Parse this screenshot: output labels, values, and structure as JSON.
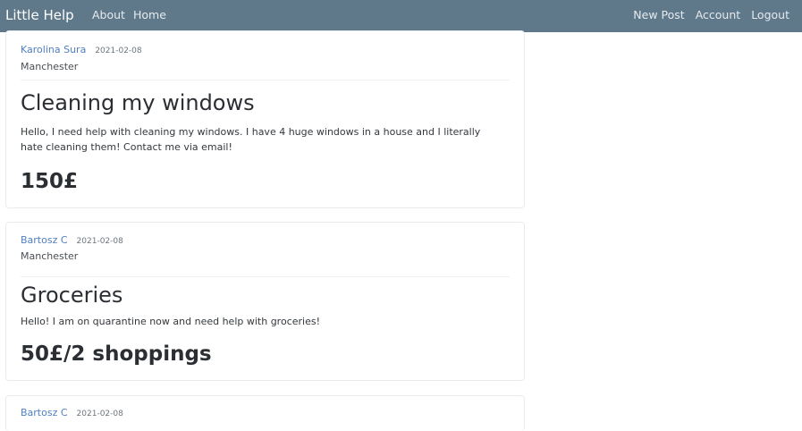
{
  "navbar": {
    "brand": "Little Help",
    "left_links": [
      "About",
      "Home"
    ],
    "right_links": [
      "New Post",
      "Account",
      "Logout"
    ]
  },
  "posts": [
    {
      "author": "Karolina Sura",
      "date": "2021-02-08",
      "location": "Manchester",
      "title": "Cleaning my windows",
      "content": "Hello, I need help with cleaning my windows. I have 4 huge windows in a house and I literally hate cleaning them! Contact me via email!",
      "price": "150£"
    },
    {
      "author": "Bartosz C",
      "date": "2021-02-08",
      "location": "Manchester",
      "title": "Groceries",
      "content": "Hello! I am on quarantine now and need help with groceries!",
      "price": "50£/2 shoppings"
    },
    {
      "author": "Bartosz C",
      "date": "2021-02-08"
    }
  ]
}
